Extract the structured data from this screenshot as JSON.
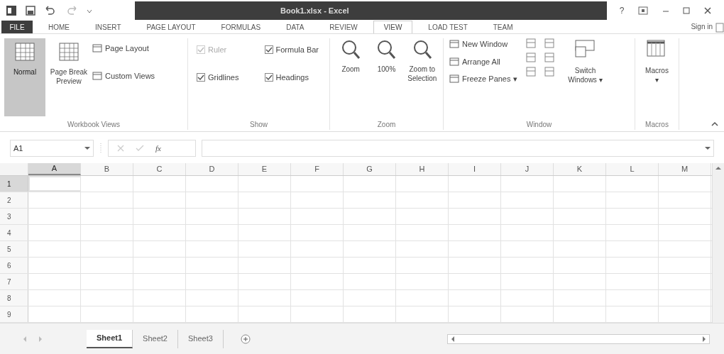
{
  "title_bar": {
    "title": "Book1.xlsx - Excel",
    "help": "?"
  },
  "ribbon_tabs": [
    {
      "label": "FILE",
      "kind": "file",
      "selected": false
    },
    {
      "label": "HOME",
      "kind": "tab",
      "selected": false
    },
    {
      "label": "INSERT",
      "kind": "tab",
      "selected": false
    },
    {
      "label": "PAGE LAYOUT",
      "kind": "tab",
      "selected": false
    },
    {
      "label": "FORMULAS",
      "kind": "tab",
      "selected": false
    },
    {
      "label": "DATA",
      "kind": "tab",
      "selected": false
    },
    {
      "label": "REVIEW",
      "kind": "tab",
      "selected": false
    },
    {
      "label": "VIEW",
      "kind": "tab",
      "selected": true
    },
    {
      "label": "LOAD TEST",
      "kind": "tab",
      "selected": false
    },
    {
      "label": "TEAM",
      "kind": "tab",
      "selected": false
    }
  ],
  "sign_in": "Sign in",
  "workbook_views": {
    "label": "Workbook Views",
    "large": [
      {
        "label": "Normal",
        "selected": true
      },
      {
        "label": "Page Break Preview",
        "selected": false
      }
    ],
    "small": [
      "Page Layout",
      "Custom Views"
    ]
  },
  "show": {
    "label": "Show",
    "checkboxes": [
      {
        "label": "Ruler",
        "checked": true,
        "disabled": true
      },
      {
        "label": "Gridlines",
        "checked": true,
        "disabled": false
      },
      {
        "label": "Formula Bar",
        "checked": true,
        "disabled": false
      },
      {
        "label": "Headings",
        "checked": true,
        "disabled": false
      }
    ]
  },
  "zoom": {
    "label": "Zoom",
    "buttons": [
      "Zoom",
      "100%",
      "Zoom to Selection"
    ]
  },
  "window": {
    "label": "Window",
    "small": [
      {
        "label": "New Window",
        "dropdown": false
      },
      {
        "label": "Arrange All",
        "dropdown": false
      },
      {
        "label": "Freeze Panes",
        "dropdown": true
      }
    ],
    "switch": "Switch Windows",
    "dropdown_mark": "▾"
  },
  "macros": {
    "label": "Macros",
    "button": "Macros",
    "dropdown_mark": "▾"
  },
  "formula_bar": {
    "name_box": "A1",
    "fx": "fx"
  },
  "grid": {
    "columns": [
      {
        "label": "A",
        "selected": true
      },
      {
        "label": "B",
        "selected": false
      },
      {
        "label": "C",
        "selected": false
      },
      {
        "label": "D",
        "selected": false
      },
      {
        "label": "E",
        "selected": false
      },
      {
        "label": "F",
        "selected": false
      },
      {
        "label": "G",
        "selected": false
      },
      {
        "label": "H",
        "selected": false
      },
      {
        "label": "I",
        "selected": false
      },
      {
        "label": "J",
        "selected": false
      },
      {
        "label": "K",
        "selected": false
      },
      {
        "label": "L",
        "selected": false
      },
      {
        "label": "M",
        "selected": false
      }
    ],
    "rows": [
      {
        "label": "1",
        "selected": true
      },
      {
        "label": "2",
        "selected": false
      },
      {
        "label": "3",
        "selected": false
      },
      {
        "label": "4",
        "selected": false
      },
      {
        "label": "5",
        "selected": false
      },
      {
        "label": "6",
        "selected": false
      },
      {
        "label": "7",
        "selected": false
      },
      {
        "label": "8",
        "selected": false
      },
      {
        "label": "9",
        "selected": false
      }
    ]
  },
  "sheets": [
    {
      "label": "Sheet1",
      "selected": true
    },
    {
      "label": "Sheet2",
      "selected": false
    },
    {
      "label": "Sheet3",
      "selected": false
    }
  ]
}
